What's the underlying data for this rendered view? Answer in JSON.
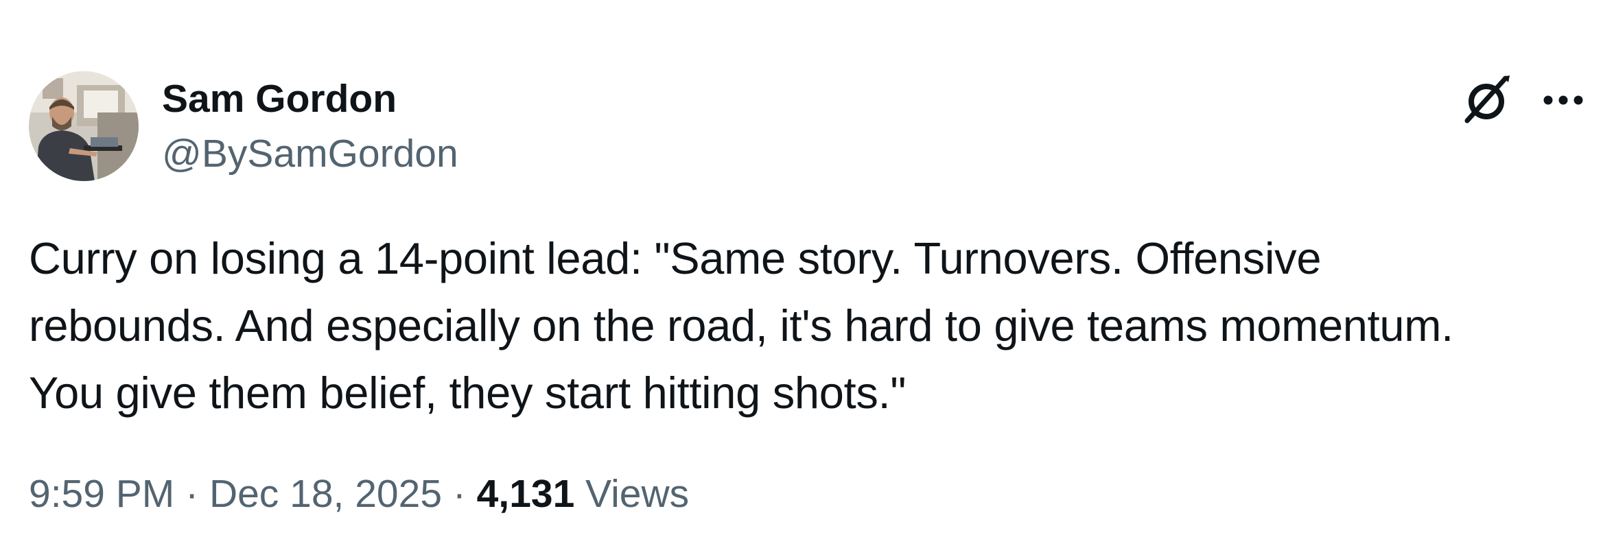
{
  "author": {
    "display_name": "Sam Gordon",
    "handle": "@BySamGordon"
  },
  "header_icons": {
    "grok": "grok-icon",
    "more": "more-horizontal-icon"
  },
  "tweet": {
    "text": "Curry on losing a 14-point lead: \"Same story. Turnovers. Offensive\nrebounds. And especially on the road, it's hard to give teams momentum.\nYou give them belief, they start hitting shots.\"",
    "time": "9:59 PM",
    "separator": " · ",
    "date": "Dec 18, 2025",
    "views_count": "4,131",
    "views_label": "Views"
  },
  "colors": {
    "text_primary": "#0f1419",
    "text_secondary": "#536471",
    "background": "#ffffff"
  }
}
